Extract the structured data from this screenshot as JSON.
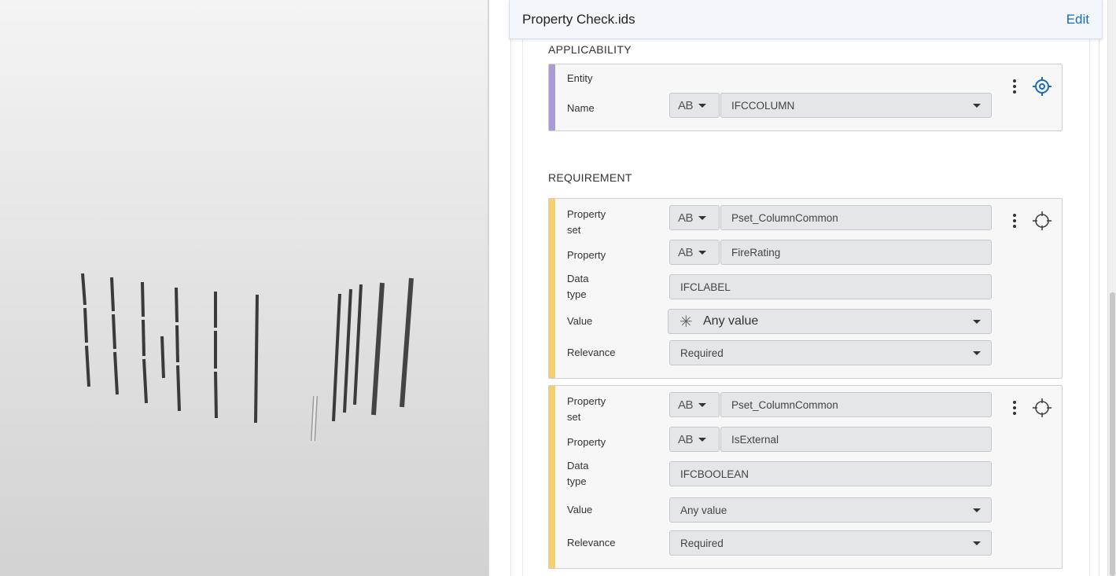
{
  "header": {
    "title": "Property Check.ids",
    "edit_label": "Edit"
  },
  "applicability": {
    "section_label": "APPLICABILITY",
    "entity_label": "Entity",
    "name_label": "Name",
    "name_type": "AB",
    "name_value": "IFCCOLUMN"
  },
  "requirement": {
    "section_label": "REQUIREMENT",
    "cards": [
      {
        "property_set_label_1": "Property",
        "property_set_label_2": "set",
        "property_set_type": "AB",
        "property_set_value": "Pset_ColumnCommon",
        "property_label": "Property",
        "property_type": "AB",
        "property_value": "FireRating",
        "datatype_label_1": "Data",
        "datatype_label_2": "type",
        "datatype_value": "IFCLABEL",
        "value_label": "Value",
        "value_value": "Any value",
        "relevance_label": "Relevance",
        "relevance_value": "Required"
      },
      {
        "property_set_label_1": "Property",
        "property_set_label_2": "set",
        "property_set_type": "AB",
        "property_set_value": "Pset_ColumnCommon",
        "property_label": "Property",
        "property_type": "AB",
        "property_value": "IsExternal",
        "datatype_label_1": "Data",
        "datatype_label_2": "type",
        "datatype_value": "IFCBOOLEAN",
        "value_label": "Value",
        "value_value": "Any value",
        "relevance_label": "Relevance",
        "relevance_value": "Required"
      }
    ]
  },
  "colors": {
    "applicability_accent": "#a99ad8",
    "requirement_accent": "#f3cf70",
    "link": "#1a6bb8"
  }
}
